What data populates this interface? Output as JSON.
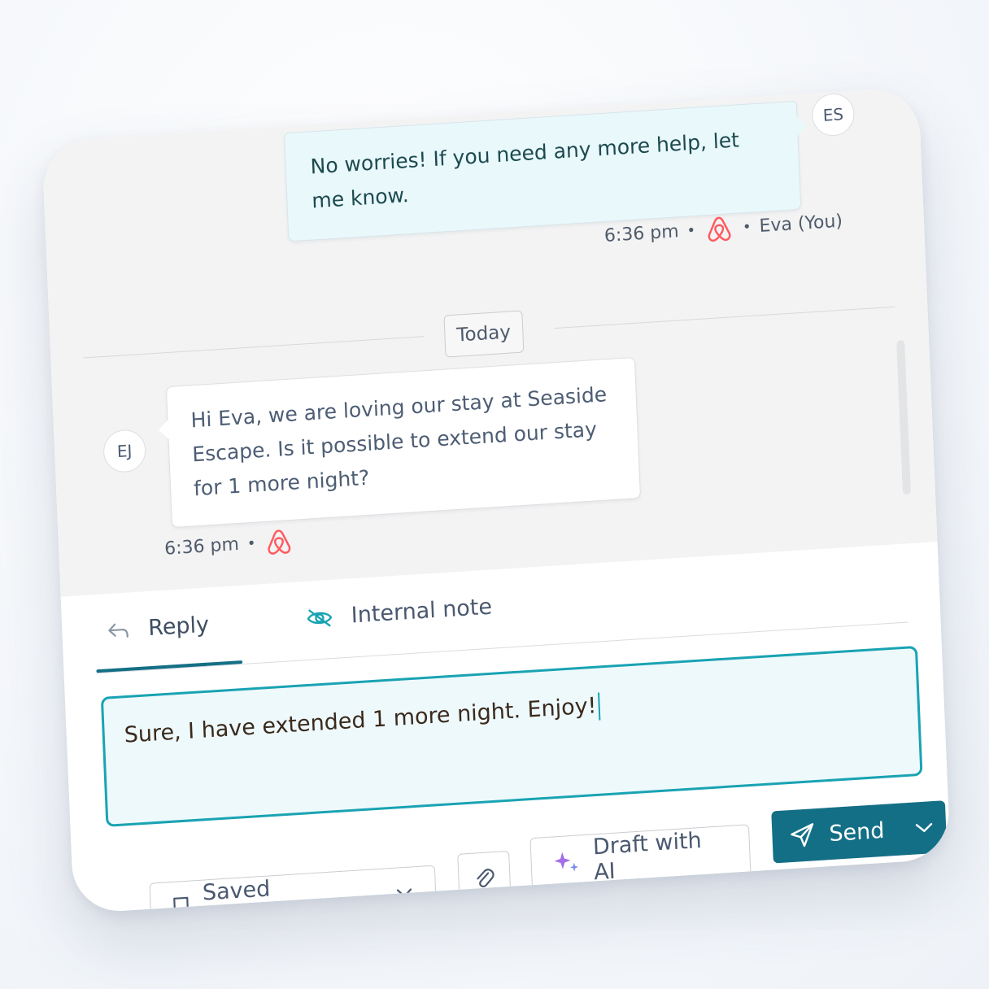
{
  "thread": {
    "agent_message": {
      "text": "No worries! If you need any more help, let me know.",
      "time": "6:36 pm",
      "sender": "Eva (You)",
      "avatar": "ES",
      "channel_icon": "airbnb-icon"
    },
    "date_divider": "Today",
    "guest_message": {
      "text": "Hi Eva, we are loving our stay at Seaside Escape. Is it possible to extend our stay for 1 more night?",
      "time": "6:36 pm",
      "avatar": "EJ",
      "channel_icon": "airbnb-icon"
    }
  },
  "composer": {
    "tabs": [
      {
        "label": "Reply",
        "icon": "reply-arrow-icon",
        "active": true
      },
      {
        "label": "Internal note",
        "icon": "eye-off-icon",
        "active": false
      }
    ],
    "draft_text": "Sure, I have extended 1 more night. Enjoy!",
    "buttons": {
      "saved_messages": "Saved messages",
      "attach_icon": "paperclip-icon",
      "draft_ai": "Draft with AI",
      "send": "Send"
    }
  },
  "colors": {
    "accent": "#136f86",
    "focus_border": "#19a3b3",
    "airbnb": "#ff5a5f",
    "ai_sparkle": "#a56ee8"
  }
}
